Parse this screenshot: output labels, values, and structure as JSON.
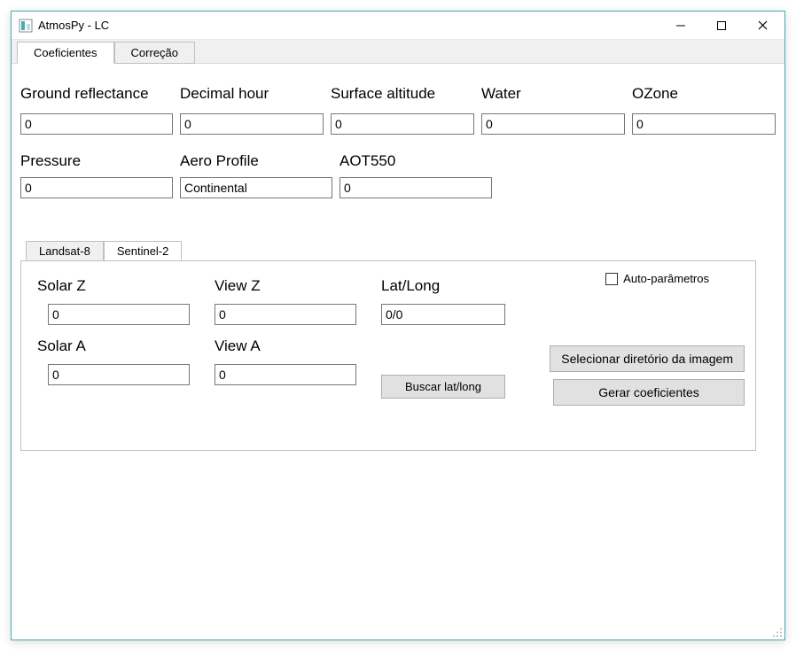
{
  "window": {
    "title": "AtmosPy - LC"
  },
  "main_tabs": {
    "coef": "Coeficientes",
    "corr": "Correção"
  },
  "fields_top": {
    "ground_reflectance": {
      "label": "Ground reflectance",
      "value": "0"
    },
    "decimal_hour": {
      "label": "Decimal hour",
      "value": "0"
    },
    "surface_altitude": {
      "label": "Surface altitude",
      "value": "0"
    },
    "water": {
      "label": "Water",
      "value": "0"
    },
    "ozone": {
      "label": "OZone",
      "value": "0"
    }
  },
  "fields_mid": {
    "pressure": {
      "label": "Pressure",
      "value": "0"
    },
    "aero": {
      "label": "Aero Profile",
      "value": "Continental"
    },
    "aot550": {
      "label": "AOT550",
      "value": "0"
    }
  },
  "sat_tabs": {
    "landsat8": "Landsat-8",
    "sentinel2": "Sentinel-2"
  },
  "sensor_fields": {
    "solar_z": {
      "label": "Solar Z",
      "value": "0"
    },
    "solar_a": {
      "label": "Solar A",
      "value": "0"
    },
    "view_z": {
      "label": "View Z",
      "value": "0"
    },
    "view_a": {
      "label": "View A",
      "value": "0"
    },
    "latlong": {
      "label": "Lat/Long",
      "value": "0/0"
    }
  },
  "checkbox": {
    "label": "Auto-parâmetros",
    "checked": false
  },
  "buttons": {
    "buscar": "Buscar lat/long",
    "select_dir": "Selecionar diretório da imagem",
    "gerar": "Gerar coeficientes"
  }
}
